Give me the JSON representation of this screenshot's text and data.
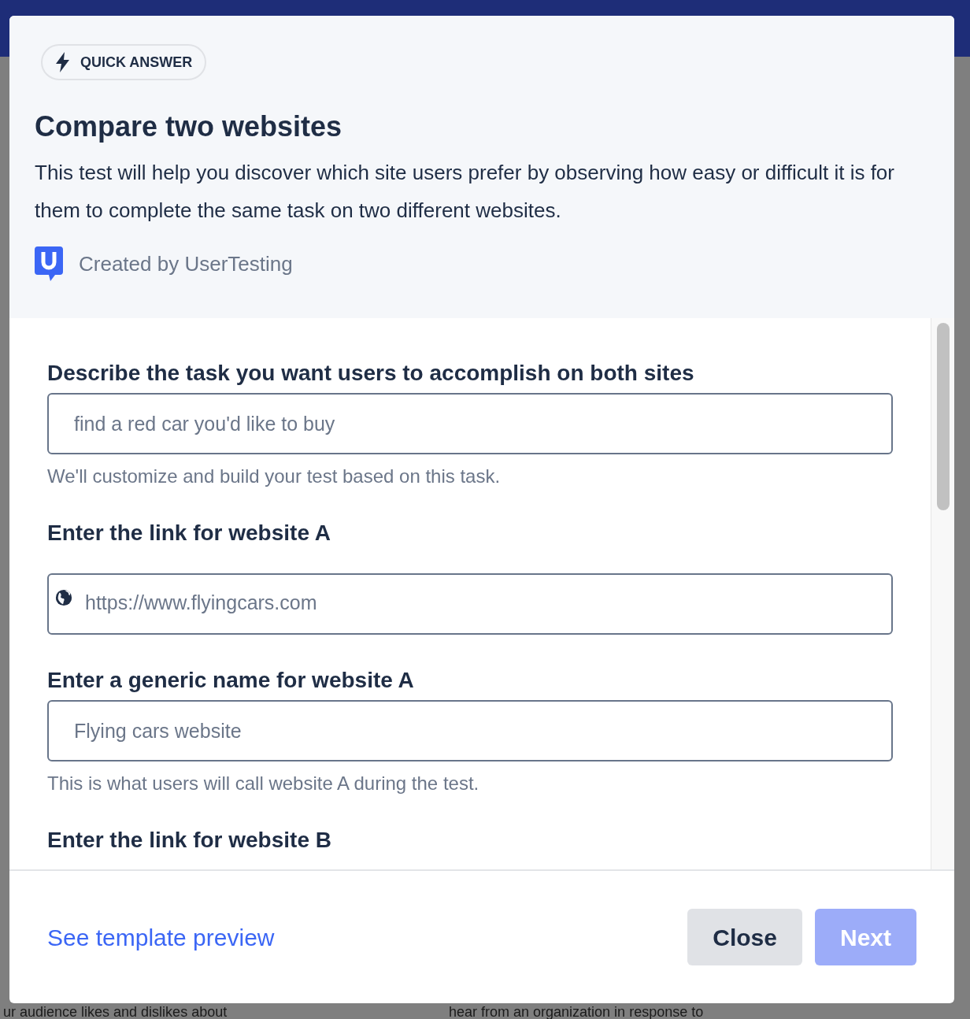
{
  "background": {
    "texts": [
      "ur audience likes and dislikes about",
      "hear from an organization in response to"
    ]
  },
  "dialog": {
    "badge": "QUICK ANSWER",
    "title": "Compare two websites",
    "description": "This test will help you discover which site users prefer by observing how easy or difficult it is for them to complete the same task on two different websites.",
    "creator": "Created by UserTesting",
    "fields": [
      {
        "kind": "text",
        "label": "Describe the task you want users to accomplish on both sites",
        "placeholder": "find a red car you'd like to buy",
        "help": "We'll customize and build your test based on this task."
      },
      {
        "kind": "url",
        "label": "Enter the link for website A",
        "placeholder": "https://www.flyingcars.com"
      },
      {
        "kind": "text",
        "label": "Enter a generic name for website A",
        "placeholder": "Flying cars website",
        "help": "This is what users will call website A during the test."
      },
      {
        "kind": "heading",
        "label": "Enter the link for website B"
      }
    ],
    "preview_link": "See template preview",
    "buttons": [
      {
        "label": "Close",
        "disabled": false
      },
      {
        "label": "Next",
        "disabled": true
      }
    ]
  }
}
